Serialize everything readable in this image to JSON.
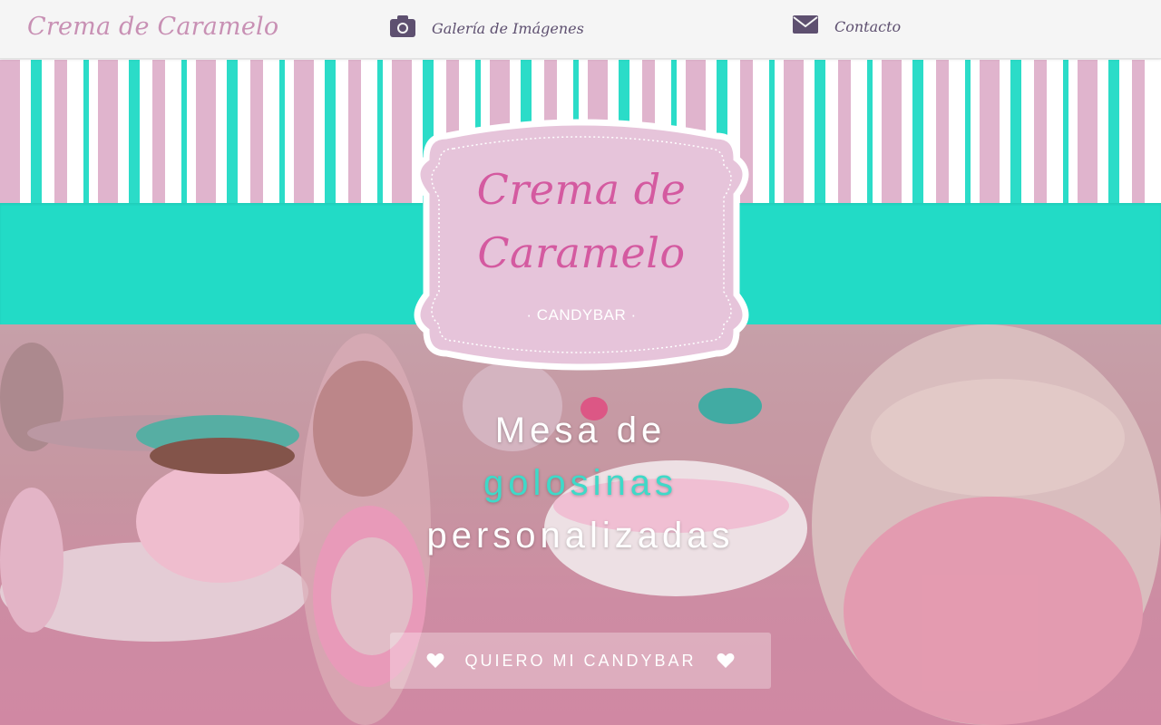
{
  "navbar": {
    "brand": "Crema de Caramelo",
    "links": [
      {
        "label": "Galería de Imágenes",
        "icon": "camera-icon"
      },
      {
        "label": "Contacto",
        "icon": "envelope-icon"
      }
    ]
  },
  "badge": {
    "line1": "Crema de",
    "line2": "Caramelo",
    "subtitle": "· CANDYBAR ·"
  },
  "headline": {
    "line1": "Mesa de",
    "line2": "golosinas",
    "line3": "personalizadas"
  },
  "cta": {
    "label": "QUIERO MI CANDYBAR",
    "icon": "heart-icon"
  },
  "colors": {
    "brand_pink": "#c890b4",
    "nav_text": "#5e5070",
    "turquoise": "#22dbc6",
    "stripe_pink": "#e0b4cd",
    "logo_text": "#d45aa0",
    "badge_fill": "#e6c4da"
  }
}
